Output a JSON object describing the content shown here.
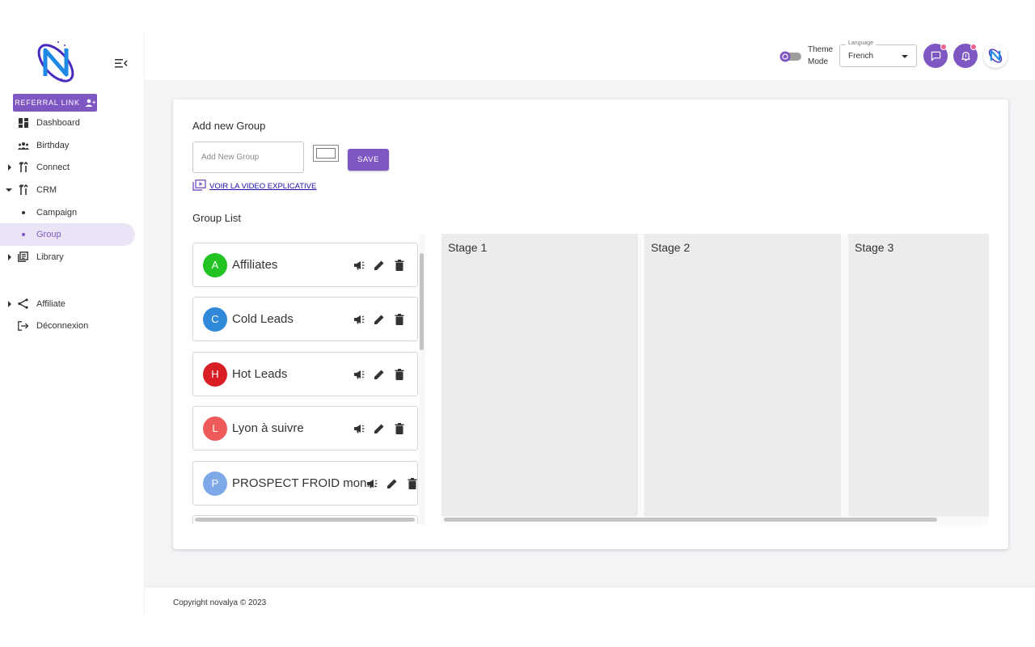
{
  "sidebar": {
    "referral_label": "REFERRAL LINK",
    "items": [
      {
        "label": "Dashboard",
        "icon": "dashboard-icon"
      },
      {
        "label": "Birthday",
        "icon": "people-icon"
      },
      {
        "label": "Connect",
        "icon": "connect-icon"
      },
      {
        "label": "CRM",
        "icon": "crm-icon"
      },
      {
        "label": "Campaign"
      },
      {
        "label": "Group"
      },
      {
        "label": "Library",
        "icon": "library-icon"
      },
      {
        "label": "Affiliate",
        "icon": "share-icon"
      },
      {
        "label": "Déconnexion",
        "icon": "logout-icon"
      }
    ]
  },
  "header": {
    "theme_label_1": "Theme",
    "theme_label_2": "Mode",
    "language_legend": "Language",
    "language_value": "French"
  },
  "main": {
    "add_heading": "Add new Group",
    "add_placeholder": "Add New Group",
    "save_label": "SAVE",
    "video_link": "VOIR LA VIDEO EXPLICATIVE",
    "list_heading": "Group List",
    "groups": [
      {
        "initial": "A",
        "name": "Affiliates",
        "color": "#22c322"
      },
      {
        "initial": "C",
        "name": "Cold Leads",
        "color": "#2f88d8"
      },
      {
        "initial": "H",
        "name": "Hot Leads",
        "color": "#d81f26"
      },
      {
        "initial": "L",
        "name": "Lyon à suivre",
        "color": "#ee5a5a"
      },
      {
        "initial": "P",
        "name": "PROSPECT FROID mon...",
        "color": "#7fa8e9"
      }
    ],
    "stages": [
      "Stage 1",
      "Stage 2",
      "Stage 3"
    ]
  },
  "footer": {
    "copyright": "Copyright novalya © 2023"
  },
  "colors": {
    "accent": "#7e57c2",
    "active_bg": "#ebe4f6",
    "notification_badge": "#f06292"
  }
}
